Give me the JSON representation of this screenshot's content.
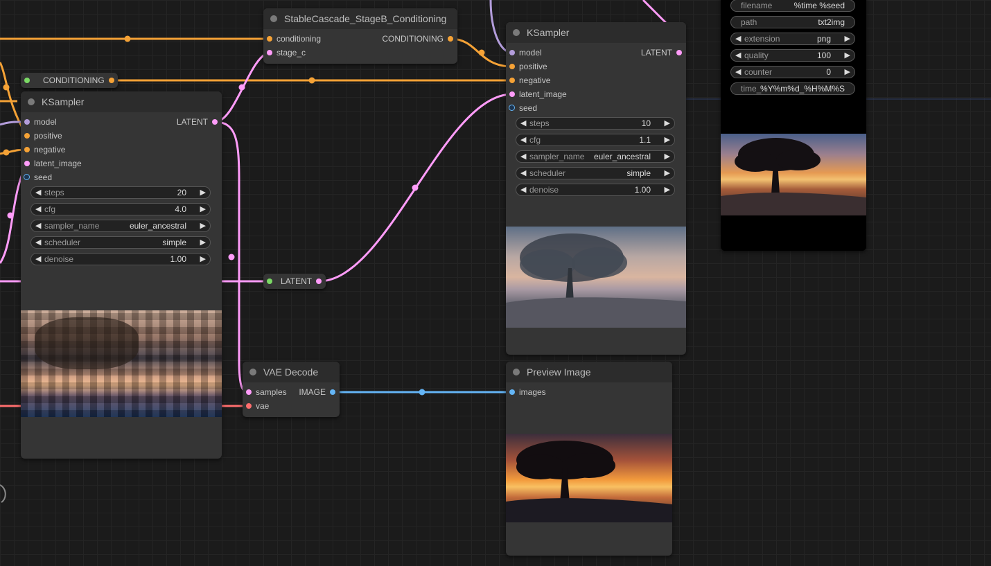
{
  "colors": {
    "conditioning": "#f5a236",
    "latent": "#ff9cf9",
    "model": "#b39ddb",
    "image": "#64b5f6",
    "vae": "#ff6e6e",
    "primitive": "#7bd965"
  },
  "reroute_conditioning": {
    "label": "CONDITIONING"
  },
  "reroute_latent": {
    "label": "LATENT"
  },
  "stageb": {
    "title": "StableCascade_StageB_Conditioning",
    "inputs": [
      "conditioning",
      "stage_c"
    ],
    "output": "CONDITIONING"
  },
  "ksampler1": {
    "title": "KSampler",
    "inputs": [
      "model",
      "positive",
      "negative",
      "latent_image",
      "seed"
    ],
    "output": "LATENT",
    "widgets": [
      {
        "label": "steps",
        "value": "20"
      },
      {
        "label": "cfg",
        "value": "4.0"
      },
      {
        "label": "sampler_name",
        "value": "euler_ancestral"
      },
      {
        "label": "scheduler",
        "value": "simple"
      },
      {
        "label": "denoise",
        "value": "1.00"
      }
    ]
  },
  "ksampler2": {
    "title": "KSampler",
    "inputs": [
      "model",
      "positive",
      "negative",
      "latent_image",
      "seed"
    ],
    "output": "LATENT",
    "widgets": [
      {
        "label": "steps",
        "value": "10"
      },
      {
        "label": "cfg",
        "value": "1.1"
      },
      {
        "label": "sampler_name",
        "value": "euler_ancestral"
      },
      {
        "label": "scheduler",
        "value": "simple"
      },
      {
        "label": "denoise",
        "value": "1.00"
      }
    ]
  },
  "vae_decode": {
    "title": "VAE Decode",
    "inputs": [
      "samples",
      "vae"
    ],
    "output": "IMAGE"
  },
  "preview": {
    "title": "Preview Image",
    "inputs": [
      "images"
    ]
  },
  "save_node": {
    "widgets": [
      {
        "label": "filename",
        "value": "%time %seed",
        "arrows": false
      },
      {
        "label": "path",
        "value": "txt2img",
        "arrows": false
      },
      {
        "label": "extension",
        "value": "png",
        "arrows": true
      },
      {
        "label": "quality",
        "value": "100",
        "arrows": true
      },
      {
        "label": "counter",
        "value": "0",
        "arrows": true
      },
      {
        "label": "time_",
        "value": "%Y%m%d_%H%M%S",
        "arrows": false
      }
    ]
  },
  "icons": {
    "left_arrow": "◀",
    "right_arrow": "▶"
  }
}
